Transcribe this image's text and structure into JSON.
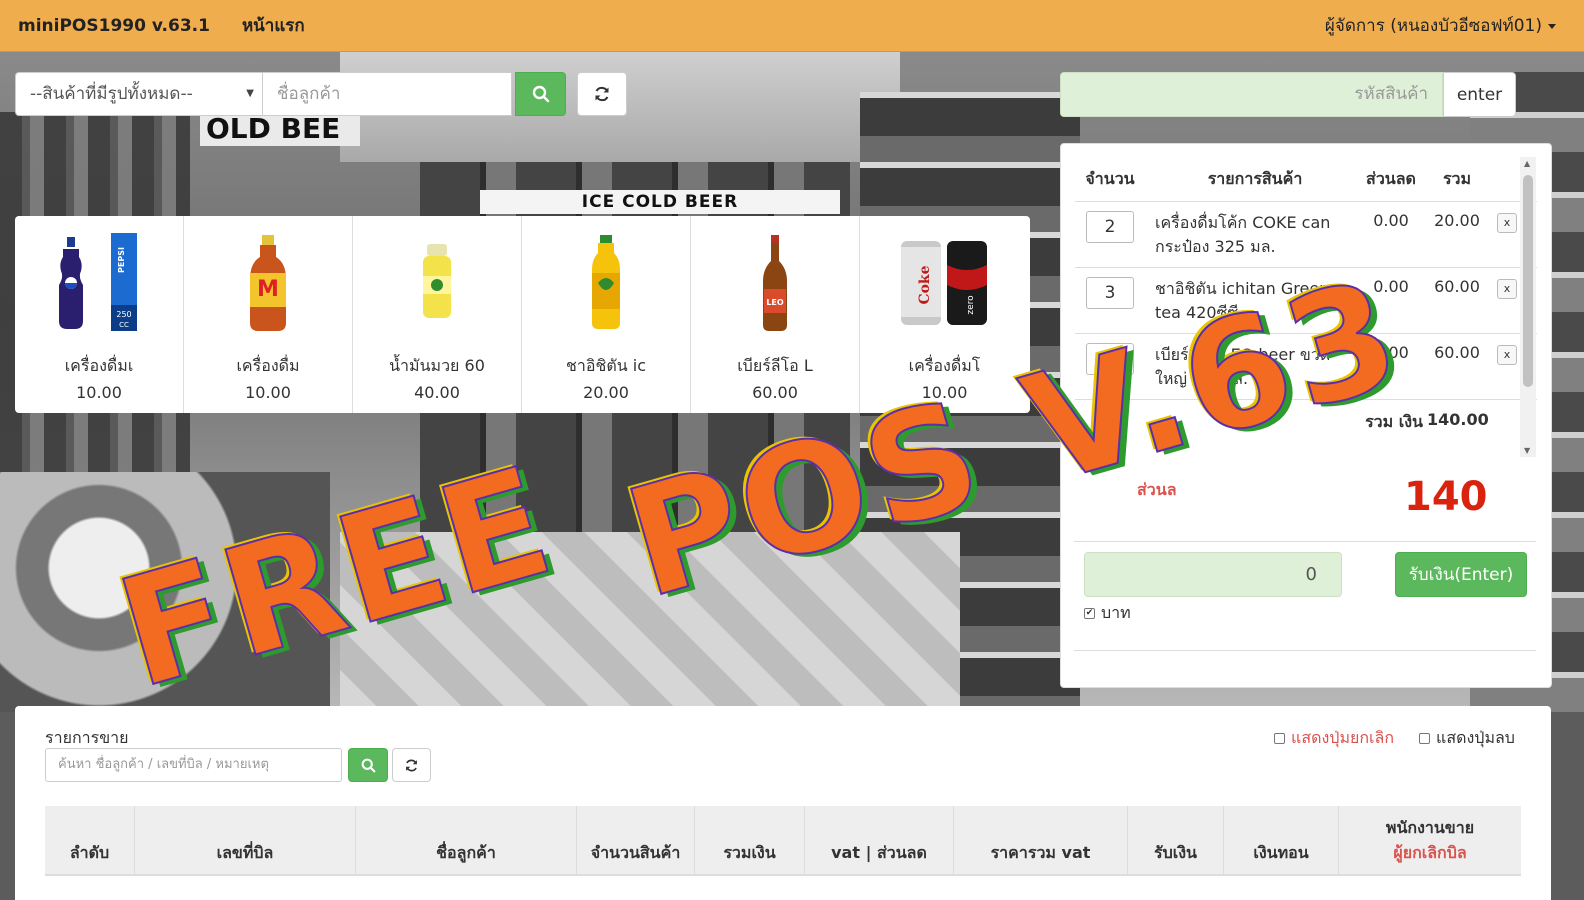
{
  "navbar": {
    "brand": "miniPOS1990 v.63.1",
    "home": "หน้าแรก",
    "user": "ผู้จัดการ (หนองบัวอีซอฟท์01)"
  },
  "filter": {
    "category_selected": "--สินค้าที่มีรูปทั้งหมด--",
    "customer_placeholder": "ชื่อลูกค้า"
  },
  "products": [
    {
      "name": "เครื่องดื่มเ",
      "price": "10.00",
      "icon": "pepsi-bottle-icon"
    },
    {
      "name": "เครื่องดื่ม",
      "price": "10.00",
      "icon": "m150-bottle-icon"
    },
    {
      "name": "น้ำมันมวย 60",
      "price": "40.00",
      "icon": "boxing-oil-icon"
    },
    {
      "name": "ชาอิชิตัน ic",
      "price": "20.00",
      "icon": "ichitan-bottle-icon"
    },
    {
      "name": "เบียร์ลีโอ L",
      "price": "60.00",
      "icon": "leo-beer-icon"
    },
    {
      "name": "เครื่องดื่มโ",
      "price": "10.00",
      "icon": "coke-cans-icon"
    }
  ],
  "product_image_text": {
    "pepsi_size": "250",
    "pepsi_unit": "CC",
    "pepsi_brand": "PEPSI",
    "m150": "M",
    "coke": "Coke",
    "zero": "zero",
    "leo": "LEO"
  },
  "cart": {
    "barcode_placeholder": "รหัสสินค้า",
    "enter_label": "enter",
    "headers": {
      "qty": "จำนวน",
      "item": "รายการสินค้า",
      "discount": "ส่วนลด",
      "sum": "รวม"
    },
    "rows": [
      {
        "qty": "2",
        "item": "เครื่องดื่มโค้ก COKE can กระป๋อง 325 มล.",
        "discount": "0.00",
        "sum": "20.00",
        "del": "x"
      },
      {
        "qty": "3",
        "item": "ชาอิชิตัน ichitan Green tea 420ซีซี",
        "discount": "0.00",
        "sum": "60.00",
        "del": "x"
      },
      {
        "qty": "1",
        "item": "เบียร์ลีโอ LEO beer ขวดใหญ่ 630มล.",
        "discount": "0.00",
        "sum": "60.00",
        "del": "x"
      }
    ],
    "total_label": "รวม เงิน",
    "total_value": "140.00",
    "discount_label": "ส่วนล",
    "grand_total": "140",
    "pay_value": "0",
    "pay_button": "รับเงิน(Enter)",
    "baht_label": "บาท"
  },
  "sales": {
    "title": "รายการขาย",
    "search_placeholder": "ค้นหา ชื่อลูกค้า / เลขที่บิล / หมายเหตุ",
    "opt_show_cancel": "แสดงปุ่มยกเลิก",
    "opt_show_delete": "แสดงปุ่มลบ",
    "columns": [
      "ลำดับ",
      "เลขที่บิล",
      "ชื่อลูกค้า",
      "จำนวนสินค้า",
      "รวมเงิน",
      "vat | ส่วนลด",
      "ราคารวม vat",
      "รับเงิน",
      "เงินทอน"
    ],
    "last_column": {
      "line1": "พนักงานขาย",
      "line2": "ผู้ยกเลิกบิล"
    }
  },
  "watermark": {
    "line1": "FREE",
    "line2": "POS V.63"
  },
  "background_signs": {
    "beer": "ICE COLD BEER",
    "bold": "OLD BEE"
  },
  "colors": {
    "navbar": "#f0ad4e",
    "success": "#5cb85c",
    "danger": "#d9534f",
    "input_green": "#dff0d8"
  }
}
